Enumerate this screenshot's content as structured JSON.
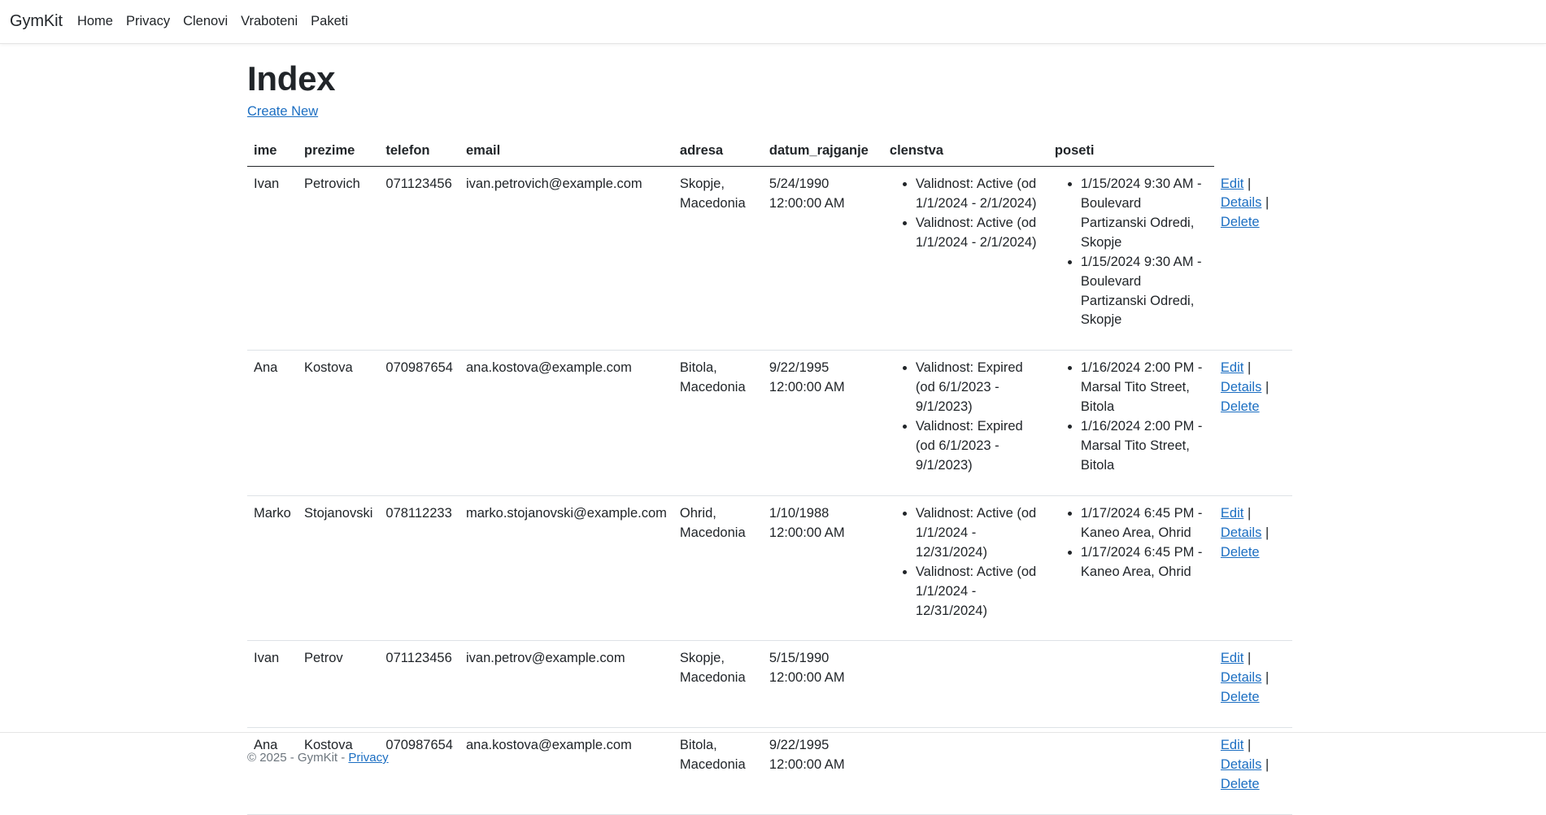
{
  "navbar": {
    "brand": "GymKit",
    "links": [
      "Home",
      "Privacy",
      "Clenovi",
      "Vraboteni",
      "Paketi"
    ]
  },
  "page": {
    "title": "Index",
    "create_new": "Create New"
  },
  "table": {
    "headers": [
      "ime",
      "prezime",
      "telefon",
      "email",
      "adresa",
      "datum_rajganje",
      "clenstva",
      "poseti"
    ],
    "actions": {
      "edit": "Edit",
      "details": "Details",
      "delete": "Delete",
      "sep": "|"
    },
    "rows": [
      {
        "ime": "Ivan",
        "prezime": "Petrovich",
        "telefon": "071123456",
        "email": "ivan.petrovich@example.com",
        "adresa": "Skopje, Macedonia",
        "datum": "5/24/1990 12:00:00 AM",
        "clenstva": [
          "Validnost: Active (od 1/1/2024 - 2/1/2024)",
          "Validnost: Active (od 1/1/2024 - 2/1/2024)"
        ],
        "poseti": [
          "1/15/2024 9:30 AM - Boulevard Partizanski Odredi, Skopje",
          "1/15/2024 9:30 AM - Boulevard Partizanski Odredi, Skopje"
        ]
      },
      {
        "ime": "Ana",
        "prezime": "Kostova",
        "telefon": "070987654",
        "email": "ana.kostova@example.com",
        "adresa": "Bitola, Macedonia",
        "datum": "9/22/1995 12:00:00 AM",
        "clenstva": [
          "Validnost: Expired (od 6/1/2023 - 9/1/2023)",
          "Validnost: Expired (od 6/1/2023 - 9/1/2023)"
        ],
        "poseti": [
          "1/16/2024 2:00 PM - Marsal Tito Street, Bitola",
          "1/16/2024 2:00 PM - Marsal Tito Street, Bitola"
        ]
      },
      {
        "ime": "Marko",
        "prezime": "Stojanovski",
        "telefon": "078112233",
        "email": "marko.stojanovski@example.com",
        "adresa": "Ohrid, Macedonia",
        "datum": "1/10/1988 12:00:00 AM",
        "clenstva": [
          "Validnost: Active (od 1/1/2024 - 12/31/2024)",
          "Validnost: Active (od 1/1/2024 - 12/31/2024)"
        ],
        "poseti": [
          "1/17/2024 6:45 PM - Kaneo Area, Ohrid",
          "1/17/2024 6:45 PM - Kaneo Area, Ohrid"
        ]
      },
      {
        "ime": "Ivan",
        "prezime": "Petrov",
        "telefon": "071123456",
        "email": "ivan.petrov@example.com",
        "adresa": "Skopje, Macedonia",
        "datum": "5/15/1990 12:00:00 AM",
        "clenstva": [],
        "poseti": []
      },
      {
        "ime": "Ana",
        "prezime": "Kostova",
        "telefon": "070987654",
        "email": "ana.kostova@example.com",
        "adresa": "Bitola, Macedonia",
        "datum": "9/22/1995 12:00:00 AM",
        "clenstva": [],
        "poseti": []
      }
    ]
  },
  "footer": {
    "text": "© 2025 - GymKit - ",
    "privacy": "Privacy"
  },
  "colors": {
    "link": "#1b6ec2",
    "text": "#212529",
    "muted": "#6c757d"
  }
}
